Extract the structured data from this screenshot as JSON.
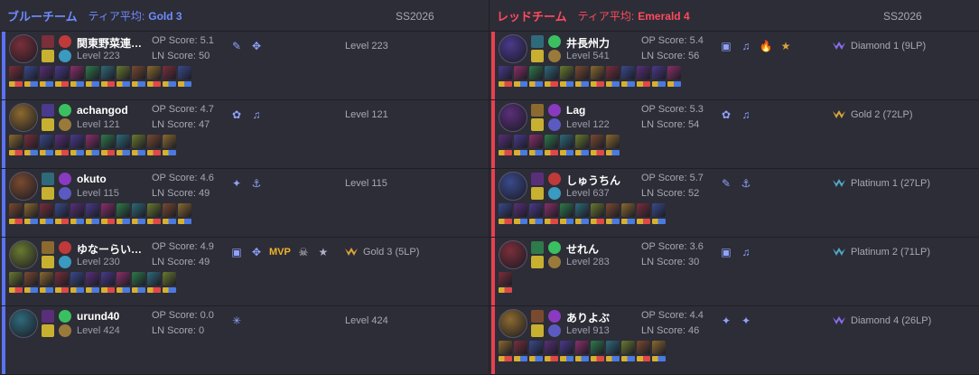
{
  "season": "SS2026",
  "teams": [
    {
      "id": "blue",
      "name": "ブルーチーム",
      "tier_label": "ティア平均:",
      "tier_value": "Gold 3",
      "players": [
        {
          "name": "関東野菜連…",
          "level": "Level 223",
          "op": "OP Score: 5.1",
          "ln": "LN Score: 50",
          "rank": "Level 223",
          "rank_icon": false,
          "badges": [
            "pencil-icon",
            "move-icon"
          ],
          "history_count": 12
        },
        {
          "name": "achangod",
          "level": "Level 121",
          "op": "OP Score: 4.7",
          "ln": "LN Score: 47",
          "rank": "Level 121",
          "rank_icon": false,
          "badges": [
            "leaf-icon",
            "megaphone-icon"
          ],
          "history_count": 11
        },
        {
          "name": "okuto",
          "level": "Level 115",
          "op": "OP Score: 4.6",
          "ln": "LN Score: 49",
          "rank": "Level 115",
          "rank_icon": false,
          "badges": [
            "sword-icon",
            "anchor-icon"
          ],
          "history_count": 12
        },
        {
          "name": "ゆなーらい…",
          "level": "Level 230",
          "op": "OP Score: 4.9",
          "ln": "LN Score: 49",
          "rank": "Gold 3 (5LP)",
          "rank_icon": true,
          "rank_color": "#d7a43a",
          "badges": [
            "frame-icon",
            "move-icon"
          ],
          "mvp": "MVP",
          "history_count": 11
        },
        {
          "name": "urund40",
          "level": "Level 424",
          "op": "OP Score: 0.0",
          "ln": "LN Score: 0",
          "rank": "Level 424",
          "rank_icon": false,
          "badges": [
            "spark-icon"
          ],
          "history_count": 0
        }
      ]
    },
    {
      "id": "red",
      "name": "レッドチーム",
      "tier_label": "ティア平均:",
      "tier_value": "Emerald 4",
      "players": [
        {
          "name": "井長州力",
          "level": "Level 541",
          "op": "OP Score: 5.4",
          "ln": "LN Score: 56",
          "rank": "Diamond 1 (9LP)",
          "rank_icon": true,
          "rank_color": "#8a6cf0",
          "badges": [
            "frame-icon",
            "megaphone-icon",
            "flame-icon",
            "medal-icon"
          ],
          "history_count": 12
        },
        {
          "name": "Lag",
          "level": "Level 122",
          "op": "OP Score: 5.3",
          "ln": "LN Score: 54",
          "rank": "Gold 2 (72LP)",
          "rank_icon": true,
          "rank_color": "#d7a43a",
          "badges": [
            "leaf-icon",
            "megaphone-icon"
          ],
          "history_count": 8
        },
        {
          "name": "しゅうちん",
          "level": "Level 637",
          "op": "OP Score: 5.7",
          "ln": "LN Score: 52",
          "rank": "Platinum 1 (27LP)",
          "rank_icon": true,
          "rank_color": "#4fa8c8",
          "badges": [
            "pencil-icon",
            "anchor-icon"
          ],
          "history_count": 11
        },
        {
          "name": "せれん",
          "level": "Level 283",
          "op": "OP Score: 3.6",
          "ln": "LN Score: 30",
          "rank": "Platinum 2 (71LP)",
          "rank_icon": true,
          "rank_color": "#4fa8c8",
          "badges": [
            "frame-icon",
            "megaphone-icon"
          ],
          "history_count": 1
        },
        {
          "name": "ありよぶ",
          "level": "Level 913",
          "op": "OP Score: 4.4",
          "ln": "LN Score: 46",
          "rank": "Diamond 4 (26LP)",
          "rank_icon": true,
          "rank_color": "#8a6cf0",
          "badges": [
            "sword-icon",
            "sword-icon"
          ],
          "history_count": 11
        }
      ]
    }
  ]
}
